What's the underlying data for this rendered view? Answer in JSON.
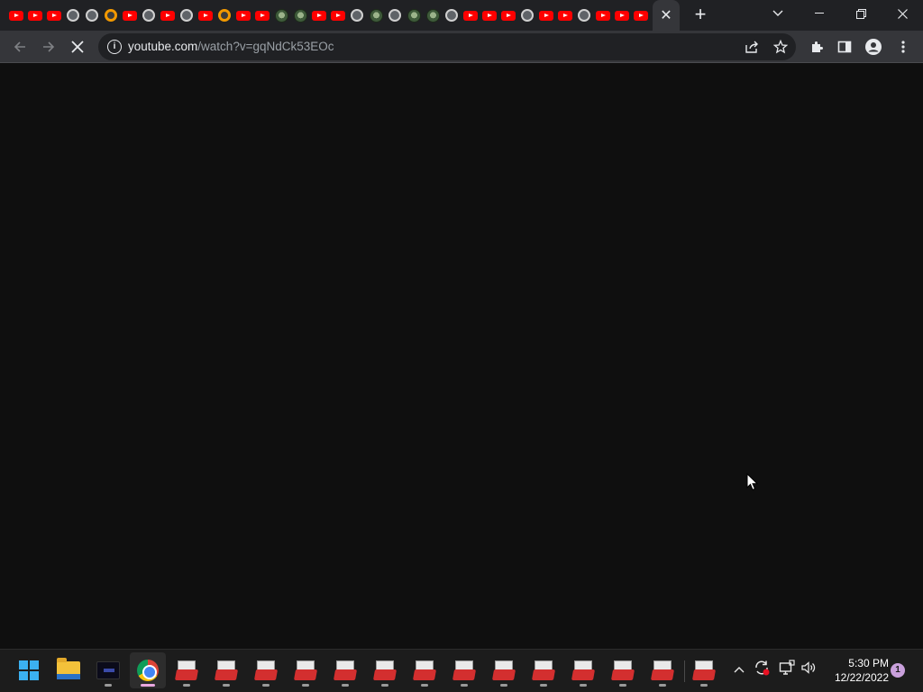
{
  "browser": {
    "tab_favicons": [
      "youtube-icon",
      "youtube-icon",
      "youtube-icon",
      "globe-icon",
      "globe-icon",
      "orange-ring-icon",
      "youtube-icon",
      "globe-icon",
      "youtube-icon",
      "globe-icon",
      "youtube-icon",
      "orange-ring-icon",
      "youtube-icon",
      "youtube-icon",
      "game-icon",
      "game-icon",
      "youtube-icon",
      "youtube-icon",
      "globe-icon",
      "game-icon",
      "globe-icon",
      "game-icon",
      "game-icon",
      "globe-icon",
      "youtube-icon",
      "youtube-icon",
      "youtube-icon",
      "globe-icon",
      "youtube-icon",
      "youtube-icon",
      "globe-icon",
      "youtube-icon",
      "youtube-icon",
      "youtube-icon",
      "youtube-icon"
    ],
    "active_tab_close": "✕",
    "new_tab": "+",
    "window_controls": {
      "tab_search": "⌄",
      "minimize": "—",
      "restore": "❐",
      "close": "✕"
    },
    "url": {
      "host": "youtube.com",
      "path": "/watch?v=gqNdCk53EOc"
    },
    "info_icon": "i"
  },
  "taskbar": {
    "apps": [
      "start-button",
      "file-explorer",
      "terminal-app",
      "chrome",
      "app-1",
      "app-2",
      "app-3",
      "app-4",
      "app-5",
      "app-6",
      "app-7",
      "app-8",
      "app-9",
      "app-10",
      "app-11",
      "app-12",
      "app-13",
      "app-14"
    ],
    "time": "5:30 PM",
    "date": "12/22/2022",
    "notification_count": "1"
  }
}
